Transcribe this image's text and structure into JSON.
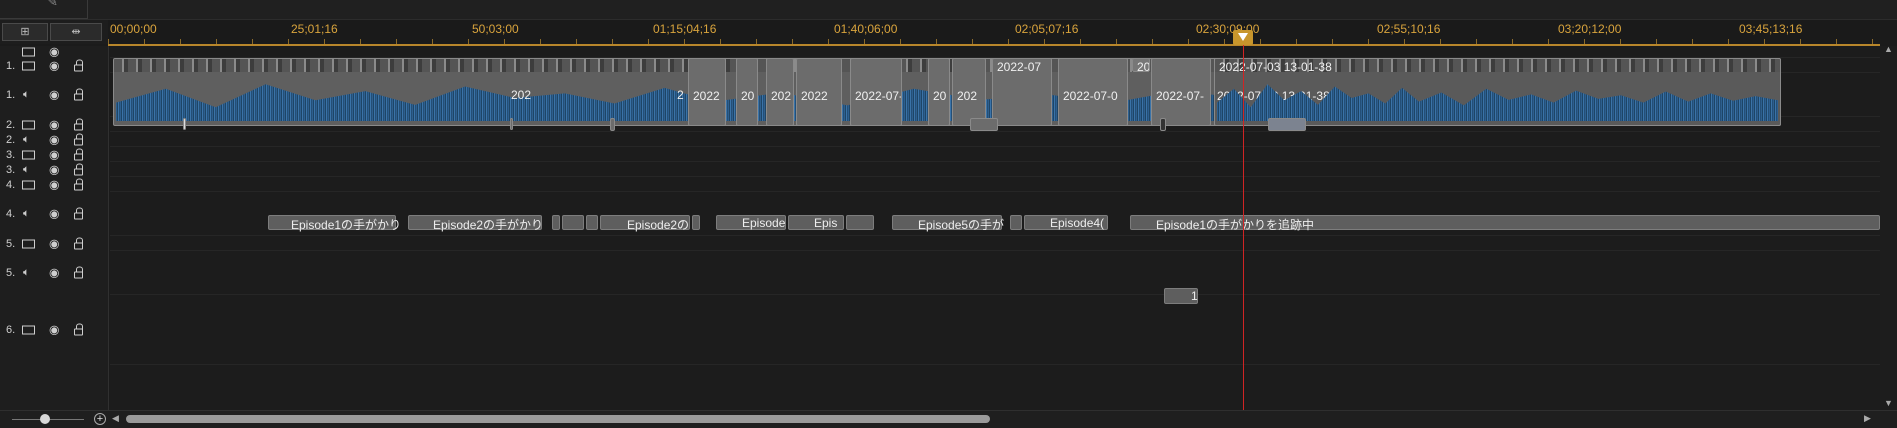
{
  "toolbar": {
    "left_button": "⊞",
    "right_button": "⇹"
  },
  "ruler": {
    "labels": [
      "00;00;00",
      "25;01;16",
      "50;03;00",
      "01;15;04;16",
      "01;40;06;00",
      "02;05;07;16",
      "02;30;09;00",
      "02;55;10;16",
      "03;20;12;00",
      "03;45;13;16"
    ]
  },
  "tracks": [
    {
      "num": "1.",
      "kind": "video"
    },
    {
      "num": "1.",
      "kind": "audio"
    },
    {
      "num": "2.",
      "kind": "video"
    },
    {
      "num": "2.",
      "kind": "audio"
    },
    {
      "num": "3.",
      "kind": "video"
    },
    {
      "num": "3.",
      "kind": "audio"
    },
    {
      "num": "4.",
      "kind": "video"
    },
    {
      "num": "4.",
      "kind": "audio"
    },
    {
      "num": "5.",
      "kind": "video"
    },
    {
      "num": "5.",
      "kind": "audio"
    },
    {
      "num": "6.",
      "kind": "video"
    }
  ],
  "clips": {
    "video_main": [
      {
        "label": "2022"
      },
      {
        "label": "20"
      },
      {
        "label": "202"
      },
      {
        "label": "2022-07"
      },
      {
        "label": "2022-07-0"
      },
      {
        "label": "2022-07-03 13-01-38"
      }
    ],
    "audio_main": [
      {
        "label": "2"
      },
      {
        "label": "202"
      },
      {
        "label": "2022"
      },
      {
        "label": "20"
      },
      {
        "label": "202"
      },
      {
        "label": "2022-07-"
      },
      {
        "label": "2022-07-0"
      },
      {
        "label": "2022-07-"
      },
      {
        "label": "2022-07-03 13-01-38"
      }
    ],
    "title_track": [
      {
        "label": "Episode1の手がかり"
      },
      {
        "label": "Episode2の手がかり"
      },
      {
        "label": "Episode2の"
      },
      {
        "label": "Episode"
      },
      {
        "label": "Epis"
      },
      {
        "label": "Episode5の手が"
      },
      {
        "label": "Episode4("
      },
      {
        "label": "Episode1の手がかりを追跡中"
      }
    ],
    "track5_clip": "1"
  },
  "colors": {
    "ruler_text": "#d9a43d",
    "playhead": "#d02424",
    "clip_fill": "#6c6c6c",
    "waveform": "#2d5f8f"
  }
}
